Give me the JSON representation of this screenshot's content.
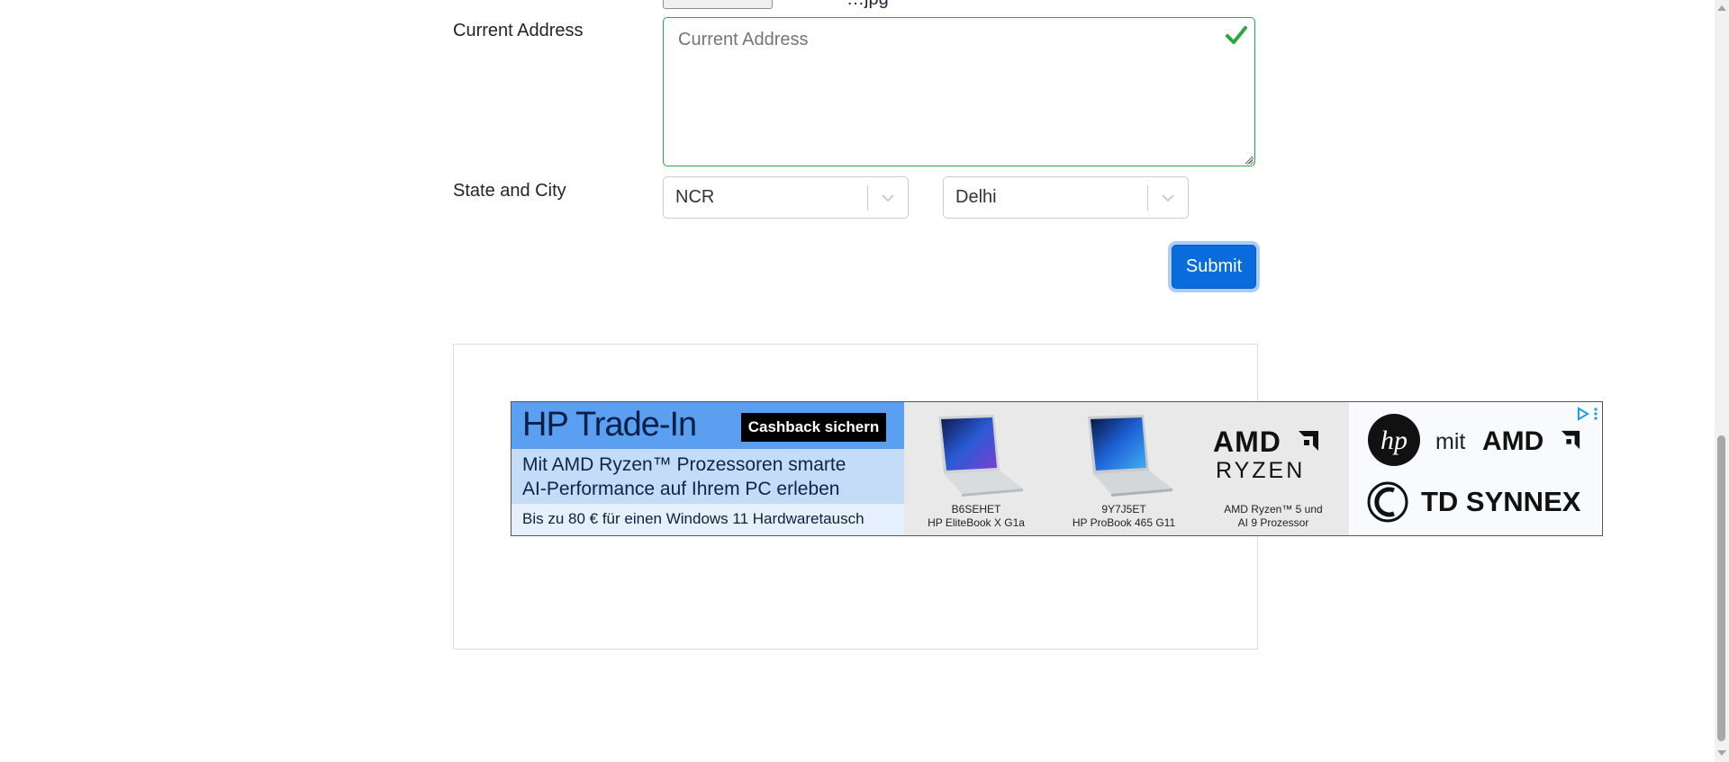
{
  "top": {
    "partial_text": "…jpg"
  },
  "address": {
    "label": "Current Address",
    "placeholder": "Current Address"
  },
  "location": {
    "label": "State and City",
    "state_value": "NCR",
    "city_value": "Delhi"
  },
  "form": {
    "submit_label": "Submit"
  },
  "ad": {
    "title": "HP Trade-In",
    "cta": "Cashback sichern",
    "subtitle_line1": "Mit AMD Ryzen™ Prozessoren smarte",
    "subtitle_line2": "AI-Performance auf Ihrem PC erleben",
    "footer": "Bis zu 80 € für einen Windows 11 Hardwaretausch",
    "products": [
      {
        "code": "B6SEHET",
        "name": "HP EliteBook X G1a"
      },
      {
        "code": "9Y7J5ET",
        "name": "HP ProBook 465 G11"
      }
    ],
    "amd_logo": "AMD",
    "ryzen_logo": "RYZEN",
    "amd_caption_line1": "AMD Ryzen™ 5 und",
    "amd_caption_line2": "AI 9 Prozessor",
    "partner_mit": "mit",
    "partner_amd": "AMD",
    "partner_td": "TD SYNNEX",
    "hp_logo": "hp"
  },
  "colors": {
    "accent": "#0a6bdc",
    "valid": "#28a745",
    "ad_blue": "#5a9ff0"
  }
}
